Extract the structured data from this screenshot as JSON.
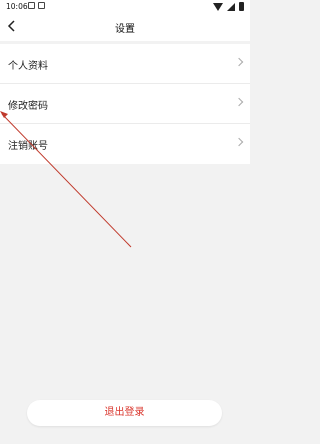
{
  "status_bar": {
    "time": "10:06"
  },
  "header": {
    "title": "设置"
  },
  "menu": {
    "items": [
      {
        "label": "个人资料"
      },
      {
        "label": "修改密码"
      },
      {
        "label": "注销账号"
      }
    ]
  },
  "footer": {
    "logout_label": "退出登录"
  },
  "colors": {
    "accent_red": "#d9342b",
    "background": "#f2f2f2"
  },
  "icons": [
    "back-arrow-icon",
    "chevron-right-icon",
    "wifi-icon",
    "signal-icon",
    "battery-icon"
  ]
}
